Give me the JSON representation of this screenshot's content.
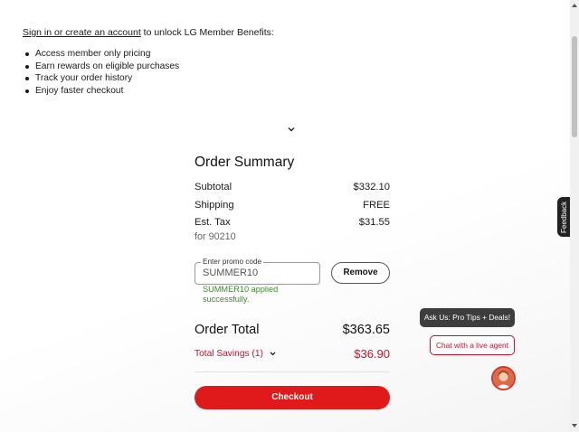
{
  "member": {
    "signin_link": "Sign in or create an account",
    "signin_suffix": " to unlock LG Member Benefits:",
    "benefits": [
      "Access member only pricing",
      "Earn rewards on eligible purchases",
      "Track your order history",
      "Enjoy faster checkout"
    ]
  },
  "summary": {
    "title": "Order Summary",
    "subtotal_label": "Subtotal",
    "subtotal_value": "$332.10",
    "shipping_label": "Shipping",
    "shipping_value": "FREE",
    "tax_label": "Est. Tax",
    "tax_value": "$31.55",
    "tax_location": "for 90210",
    "promo_label": "Enter promo code",
    "promo_value": "SUMMER10",
    "remove_label": "Remove",
    "promo_message": "SUMMER10 applied successfully.",
    "total_label": "Order Total",
    "total_value": "$363.65",
    "savings_label": "Total Savings (1)",
    "savings_value": "$36.90",
    "checkout_label": "Checkout"
  },
  "chat": {
    "tips_label": "Ask Us: Pro Tips + Deals!",
    "agent_label": "Chat with a live agent"
  },
  "feedback_label": "Feedback",
  "colors": {
    "accent_red": "#e0191a",
    "savings_red": "#c8102e",
    "success_green": "#3c8a2c",
    "tips_bubble": "#3d3d3d"
  },
  "icons": [
    "chevron-down-icon",
    "chevron-down-small-icon",
    "scroll-up-arrow-icon",
    "scroll-down-arrow-icon"
  ]
}
